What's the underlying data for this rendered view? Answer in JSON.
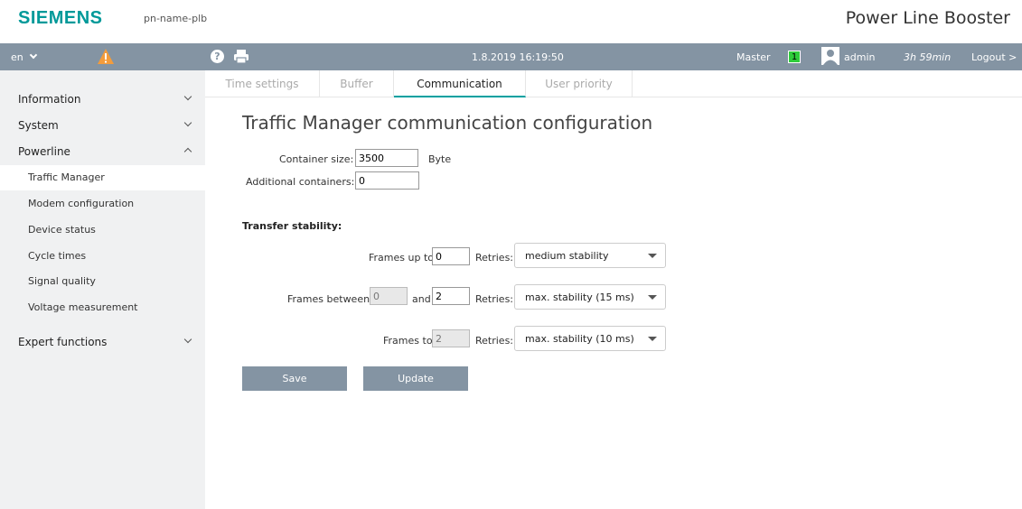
{
  "brand": {
    "logo": "SIEMENS",
    "device_name": "pn-name-plb",
    "product": "Power Line Booster"
  },
  "header": {
    "language": "en",
    "datetime": "1.8.2019 16:19:50",
    "master_label": "Master",
    "master_badge": "1",
    "user": "admin",
    "session_time": "3h 59min",
    "logout": "Logout >",
    "colors": {
      "bar": "#8494a3",
      "badge": "#2ecc3a",
      "warning": "#f39c3c"
    }
  },
  "sidebar": {
    "sections": [
      {
        "label": "Information",
        "expanded": false
      },
      {
        "label": "System",
        "expanded": false
      },
      {
        "label": "Powerline",
        "expanded": true
      },
      {
        "label": "Expert functions",
        "expanded": false
      }
    ],
    "powerline_items": [
      {
        "label": "Traffic Manager",
        "active": true
      },
      {
        "label": "Modem configuration"
      },
      {
        "label": "Device status"
      },
      {
        "label": "Cycle times"
      },
      {
        "label": "Signal quality"
      },
      {
        "label": "Voltage measurement"
      }
    ]
  },
  "tabs": [
    {
      "label": "Time settings"
    },
    {
      "label": "Buffer"
    },
    {
      "label": "Communication",
      "active": true
    },
    {
      "label": "User priority"
    }
  ],
  "main": {
    "title": "Traffic Manager communication configuration",
    "container_size": {
      "label": "Container size:",
      "value": "3500",
      "unit": "Byte"
    },
    "additional_containers": {
      "label": "Additional containers:",
      "value": "0"
    },
    "transfer_stability": {
      "label": "Transfer stability:",
      "row1": {
        "label": "Frames up to",
        "value": "0",
        "retries_label": "Retries:",
        "retries": "medium stability"
      },
      "row2": {
        "label": "Frames between",
        "from": "0",
        "and_label": "and",
        "to": "2",
        "retries_label": "Retries:",
        "retries": "max. stability (15 ms)"
      },
      "row3": {
        "label": "Frames to",
        "value": "2",
        "retries_label": "Retries:",
        "retries": "max. stability (10 ms)"
      }
    },
    "buttons": {
      "save": "Save",
      "update": "Update"
    }
  }
}
